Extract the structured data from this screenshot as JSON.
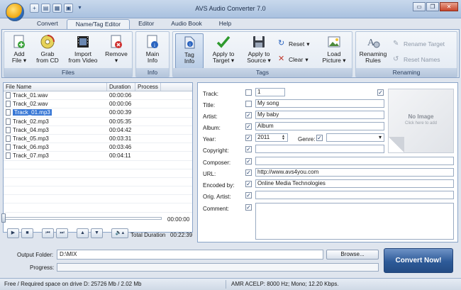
{
  "window": {
    "title": "AVS Audio Converter 7.0",
    "quick_access": [
      "new-icon",
      "open-icon",
      "video-icon",
      "save-icon",
      "dropdown-icon"
    ],
    "controls": [
      "minimize",
      "restore",
      "close"
    ],
    "control_glyphs": [
      "▭",
      "❐",
      "✕"
    ]
  },
  "tabs": [
    {
      "label": "Convert",
      "active": false
    },
    {
      "label": "Name/Tag Editor",
      "active": true
    },
    {
      "label": "Editor",
      "active": false
    },
    {
      "label": "Audio Book",
      "active": false
    },
    {
      "label": "Help",
      "active": false
    }
  ],
  "ribbon": {
    "files": {
      "label": "Files",
      "add": "Add\nFile ▾",
      "grab": "Grab\nfrom CD",
      "import": "Import\nfrom Video",
      "remove": "Remove\n▾"
    },
    "info": {
      "label": "Info",
      "main_info": "Main\nInfo"
    },
    "tags": {
      "label": "Tags",
      "tag_info": "Tag\nInfo",
      "apply_target": "Apply to\nTarget ▾",
      "apply_source": "Apply to\nSource ▾",
      "reset": "Reset",
      "clear": "Clear",
      "load_picture": "Load\nPicture ▾"
    },
    "renaming": {
      "label": "Renaming",
      "rules": "Renaming\nRules",
      "rename_target": "Rename Target",
      "reset_names": "Reset Names"
    }
  },
  "file_list": {
    "columns": [
      "File Name",
      "Duration",
      "Process"
    ],
    "rows": [
      {
        "name": "Track_01.wav",
        "duration": "00:00:06",
        "selected": false
      },
      {
        "name": "Track_02.wav",
        "duration": "00:00:06",
        "selected": false
      },
      {
        "name": "Track_01.mp3",
        "duration": "00:00:39",
        "selected": true
      },
      {
        "name": "Track_02.mp3",
        "duration": "00:05:35",
        "selected": false
      },
      {
        "name": "Track_04.mp3",
        "duration": "00:04:42",
        "selected": false
      },
      {
        "name": "Track_05.mp3",
        "duration": "00:03:31",
        "selected": false
      },
      {
        "name": "Track_06.mp3",
        "duration": "00:03:46",
        "selected": false
      },
      {
        "name": "Track_07.mp3",
        "duration": "00:04:11",
        "selected": false
      }
    ]
  },
  "player": {
    "position": "00:00:00",
    "total_label": "Total Duration",
    "total_value": "00:22:39",
    "buttons": [
      "play-icon",
      "stop-icon",
      "previous-icon",
      "next-icon",
      "move-up-icon",
      "move-down-icon",
      "volume-icon"
    ],
    "button_glyphs": [
      "▶",
      "■",
      "⏮",
      "⏭",
      "▲",
      "▼",
      "🔈▴"
    ]
  },
  "tags": {
    "track": {
      "label": "Track:",
      "value": "1",
      "checked": false
    },
    "title": {
      "label": "Title:",
      "value": "My song",
      "checked": false
    },
    "artist": {
      "label": "Artist:",
      "value": "My baby",
      "checked": true
    },
    "album": {
      "label": "Album:",
      "value": "Album",
      "checked": true
    },
    "year": {
      "label": "Year:",
      "value": "2011",
      "checked": true
    },
    "genre": {
      "label": "Genre:",
      "value": "",
      "checked": true
    },
    "copyright": {
      "label": "Copyright:",
      "value": "",
      "checked": true
    },
    "composer": {
      "label": "Composer:",
      "value": "",
      "checked": true
    },
    "url": {
      "label": "URL:",
      "value": "http://www.avs4you.com",
      "checked": true
    },
    "encoded_by": {
      "label": "Encoded by:",
      "value": "Online Media Technologies",
      "checked": true
    },
    "orig_artist": {
      "label": "Orig. Artist:",
      "value": "",
      "checked": true
    },
    "comment": {
      "label": "Comment:",
      "value": "",
      "checked": true
    },
    "cover_checked": true,
    "cover_title": "No Image",
    "cover_hint": "Click here to add"
  },
  "output": {
    "folder_label": "Output Folder:",
    "folder_value": "D:\\MIX",
    "browse": "Browse...",
    "progress_label": "Progress:",
    "progress": 0,
    "convert": "Convert Now!"
  },
  "status": {
    "space": "Free / Required space on drive  D: 25726 Mb / 2.02 Mb",
    "format": "AMR ACELP: 8000  Hz; Mono; 12.20 Kbps."
  },
  "colors": {
    "accent": "#2d5a98",
    "selection": "#3a79d6"
  }
}
